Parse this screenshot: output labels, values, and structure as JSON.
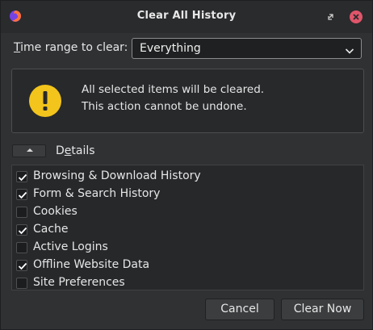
{
  "window": {
    "title": "Clear All History",
    "icons": [
      "firefox-icon",
      "restore-icon",
      "close-icon"
    ]
  },
  "time_range": {
    "label_underlined": "T",
    "label_rest": "ime range to clear:",
    "selected": "Everything"
  },
  "warning": {
    "line1": "All selected items will be cleared.",
    "line2": "This action cannot be undone.",
    "icon": "warning-icon",
    "icon_color": "#f2c41c"
  },
  "details": {
    "label_before": "D",
    "label_underlined": "e",
    "label_after": "tails"
  },
  "items": [
    {
      "label": "Browsing & Download History",
      "checked": true
    },
    {
      "label": "Form & Search History",
      "checked": true
    },
    {
      "label": "Cookies",
      "checked": false
    },
    {
      "label": "Cache",
      "checked": true
    },
    {
      "label": "Active Logins",
      "checked": false
    },
    {
      "label": "Offline Website Data",
      "checked": true
    },
    {
      "label": "Site Preferences",
      "checked": false
    }
  ],
  "buttons": {
    "cancel": "Cancel",
    "clear": "Clear Now"
  },
  "colors": {
    "background": "#2f3133",
    "close_button": "#e0556a"
  }
}
